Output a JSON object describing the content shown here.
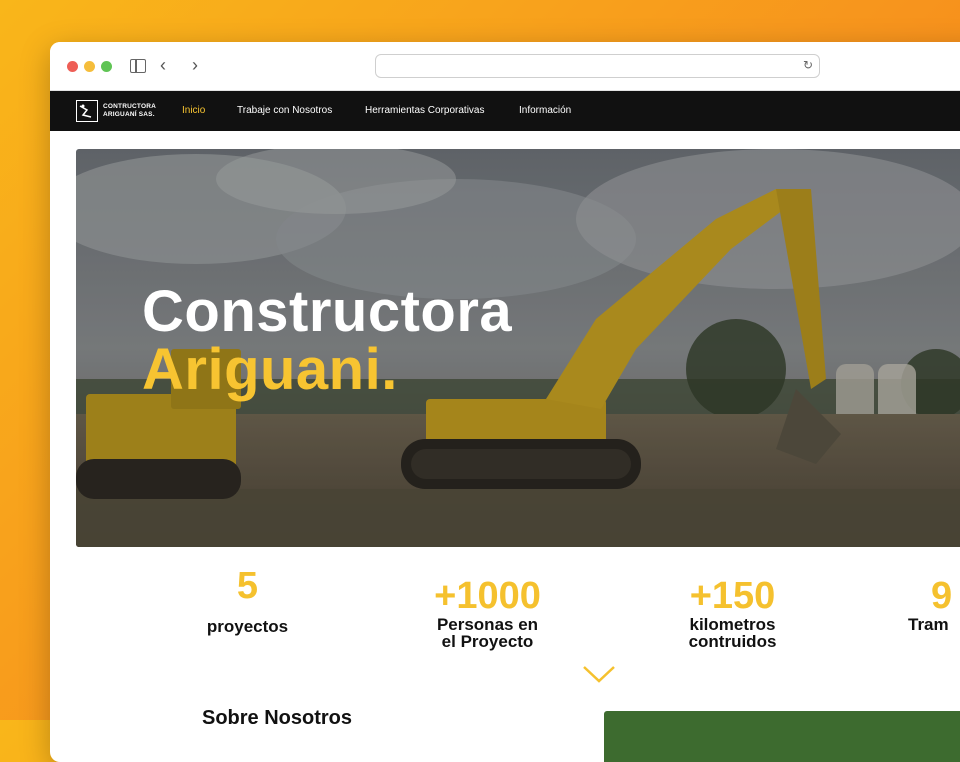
{
  "navbar": {
    "logo_line1": "CONTRUCTORA",
    "logo_line2": "ARIGUANÍ SAS.",
    "items": [
      {
        "label": "Inicio",
        "active": true
      },
      {
        "label": "Trabaje con Nosotros",
        "active": false
      },
      {
        "label": "Herramientas Corporativas",
        "active": false
      },
      {
        "label": "Información",
        "active": false
      }
    ]
  },
  "hero": {
    "title_line1": "Constructora",
    "title_line2": "Ariguani."
  },
  "stats": [
    {
      "number": "5",
      "label_line1": "proyectos",
      "label_line2": ""
    },
    {
      "number": "+1000",
      "label_line1": "Personas en",
      "label_line2": "el Proyecto"
    },
    {
      "number": "+150",
      "label_line1": "kilometros",
      "label_line2": "contruidos"
    },
    {
      "number": "9",
      "label_line1": "Tram",
      "label_line2": ""
    }
  ],
  "about": {
    "title": "Sobre Nosotros"
  },
  "colors": {
    "accent": "#f7c431",
    "nav_bg": "#111111",
    "page_bg_gradient": [
      "#f9b61a",
      "#f27a12"
    ]
  }
}
